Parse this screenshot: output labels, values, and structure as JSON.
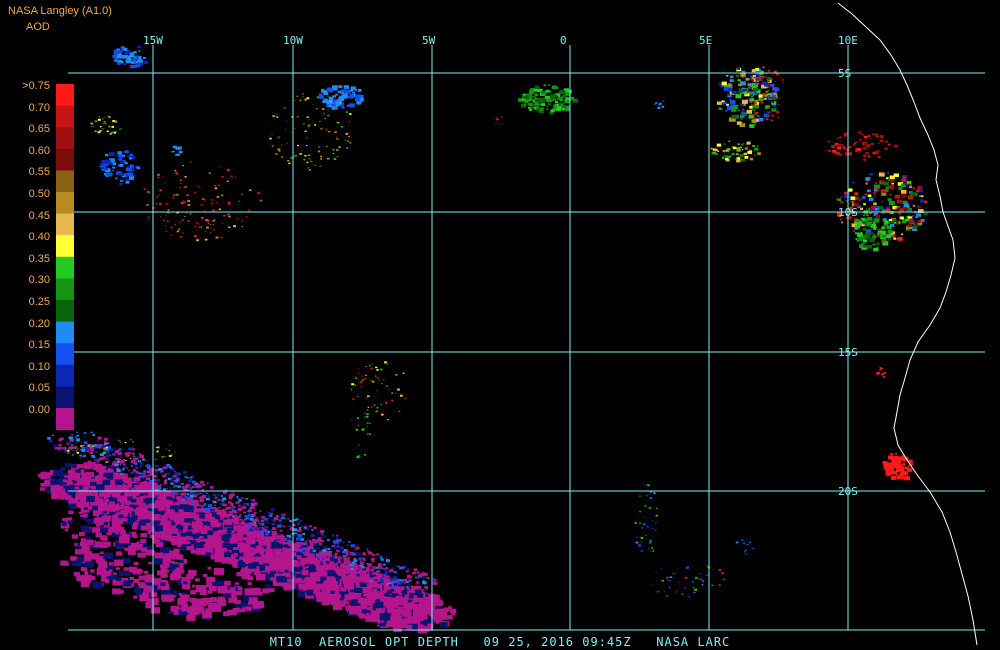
{
  "header": {
    "title": "NASA Langley (A1.0)",
    "subtitle": "AOD"
  },
  "legend": {
    "ticks": [
      ">0.75",
      "0.70",
      "0.65",
      "0.60",
      "0.55",
      "0.50",
      "0.45",
      "0.40",
      "0.35",
      "0.30",
      "0.25",
      "0.20",
      "0.15",
      "0.10",
      "0.05",
      "0.00"
    ],
    "colors": [
      "#ff1a1a",
      "#c81414",
      "#a01010",
      "#7a0c0c",
      "#8a6014",
      "#b88a22",
      "#e8b850",
      "#ffff33",
      "#22cc22",
      "#149614",
      "#0a640a",
      "#1e8cf0",
      "#1450f0",
      "#0a28b4",
      "#0a1470",
      "#b4148c"
    ]
  },
  "grid": {
    "lon_labels": [
      "15W",
      "10W",
      "5W",
      "0",
      "5E",
      "10E"
    ],
    "lat_labels": [
      "5S",
      "10S",
      "15S",
      "20S"
    ]
  },
  "footer": {
    "text": "MT10  AEROSOL OPT DEPTH   09 25, 2016 09:45Z   NASA LARC"
  },
  "colors": {
    "grid": "#7ff0f0",
    "label": "#f0a850",
    "coast": "#ffffff",
    "background": "#000000"
  }
}
